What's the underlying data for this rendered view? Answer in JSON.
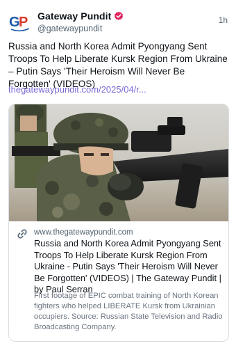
{
  "post": {
    "author_name": "Gateway Pundit",
    "author_handle": "@gatewaypundit",
    "avatar_text": "GP",
    "timestamp": "1h",
    "text": "Russia and North Korea Admit Pyongyang Sent Troops To Help Liberate Kursk Region From Ukraine – Putin Says 'Their Heroism Will Never Be Forgotten' (VIDEOS)",
    "link_text": "thegatewaypundit.com/2025/04/r..."
  },
  "card": {
    "domain": "www.thegatewaypundit.com",
    "title": "Russia and North Korea Admit Pyongyang Sent Troops To Help Liberate Kursk Region From Ukraine - Putin Says 'Their Heroism Will Never Be Forgotten' (VIDEOS) | The Gateway Pundit | by Paul Serran",
    "description": "First footage of EPIC combat training of North Korean fighters who helped LIBERATE Kursk from Ukrainian occupiers. Source: Russian State Television and Radio Broadcasting Company.",
    "image_icon": "soldier-photo"
  },
  "colors": {
    "text": "#0f1419",
    "muted": "#536471",
    "link": "#7a6ad6",
    "verified": "#e0245e",
    "avatar_blue": "#1c5aa8",
    "avatar_red": "#d93a2b"
  },
  "icons": {
    "verified": "verified-badge-icon",
    "link": "link-chain-icon"
  }
}
